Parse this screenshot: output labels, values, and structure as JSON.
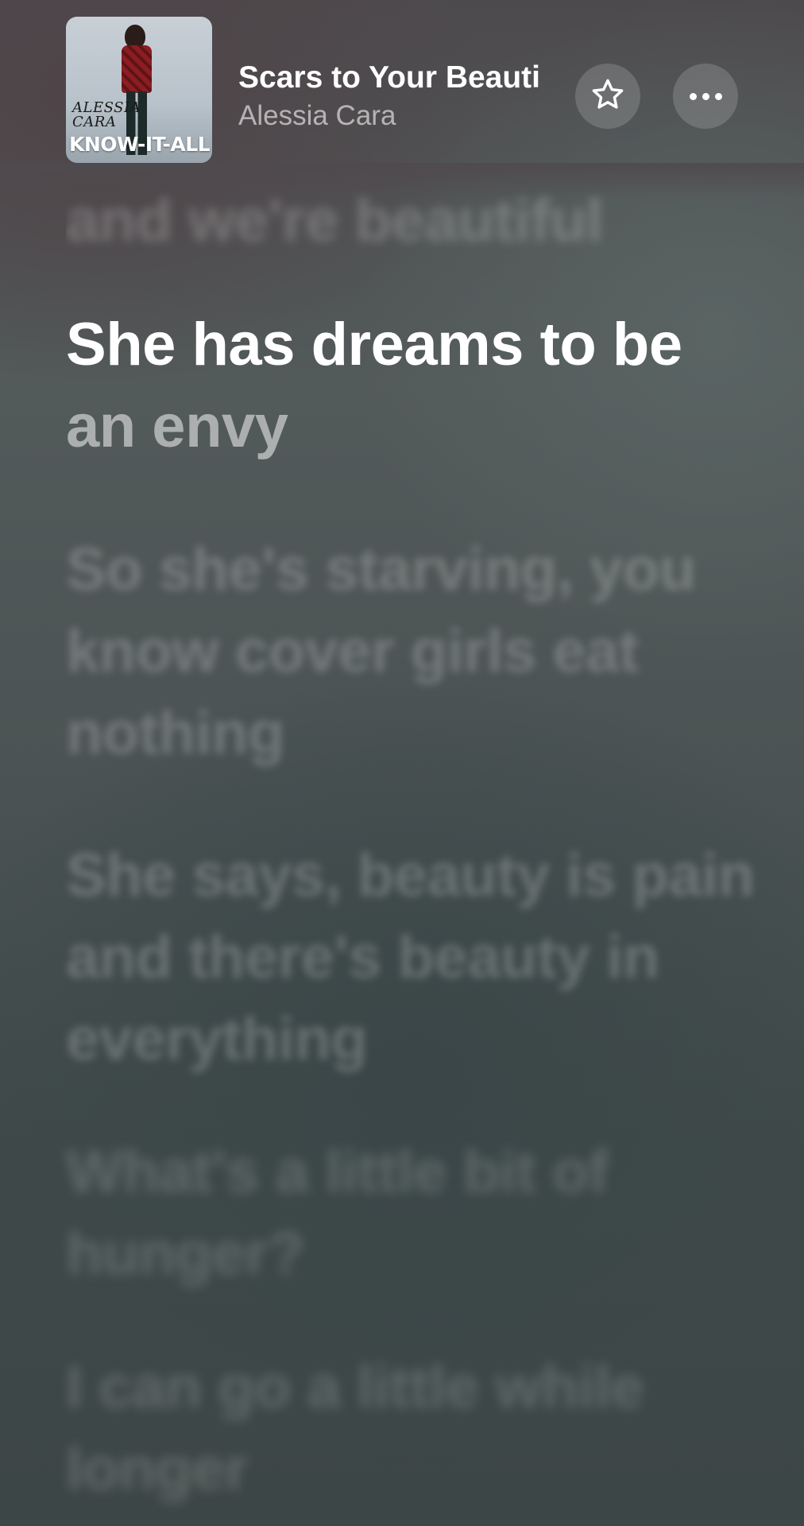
{
  "now_playing": {
    "album_art": {
      "artist_text": "ALESSIA CARA",
      "title_text": "KNOW-IT-ALL"
    },
    "title": "Scars to Your Beauti",
    "artist": "Alessia Cara",
    "favorite_icon": "star-outline-icon",
    "more_icon": "ellipsis-icon"
  },
  "lyrics": {
    "previous_line": "and we're beautiful",
    "current_line": {
      "sung": "She has dreams to be ",
      "unsung": "an envy"
    },
    "upcoming": [
      "So she's starving, you know cover girls eat nothing",
      "She says, beauty is pain and there's beauty in everything",
      "What's a little bit of hunger?",
      "I can go a little while longer"
    ]
  },
  "colors": {
    "text_primary": "#ffffff",
    "text_secondary": "rgba(255,255,255,0.58)",
    "button_bg": "rgba(255,255,255,0.16)"
  }
}
